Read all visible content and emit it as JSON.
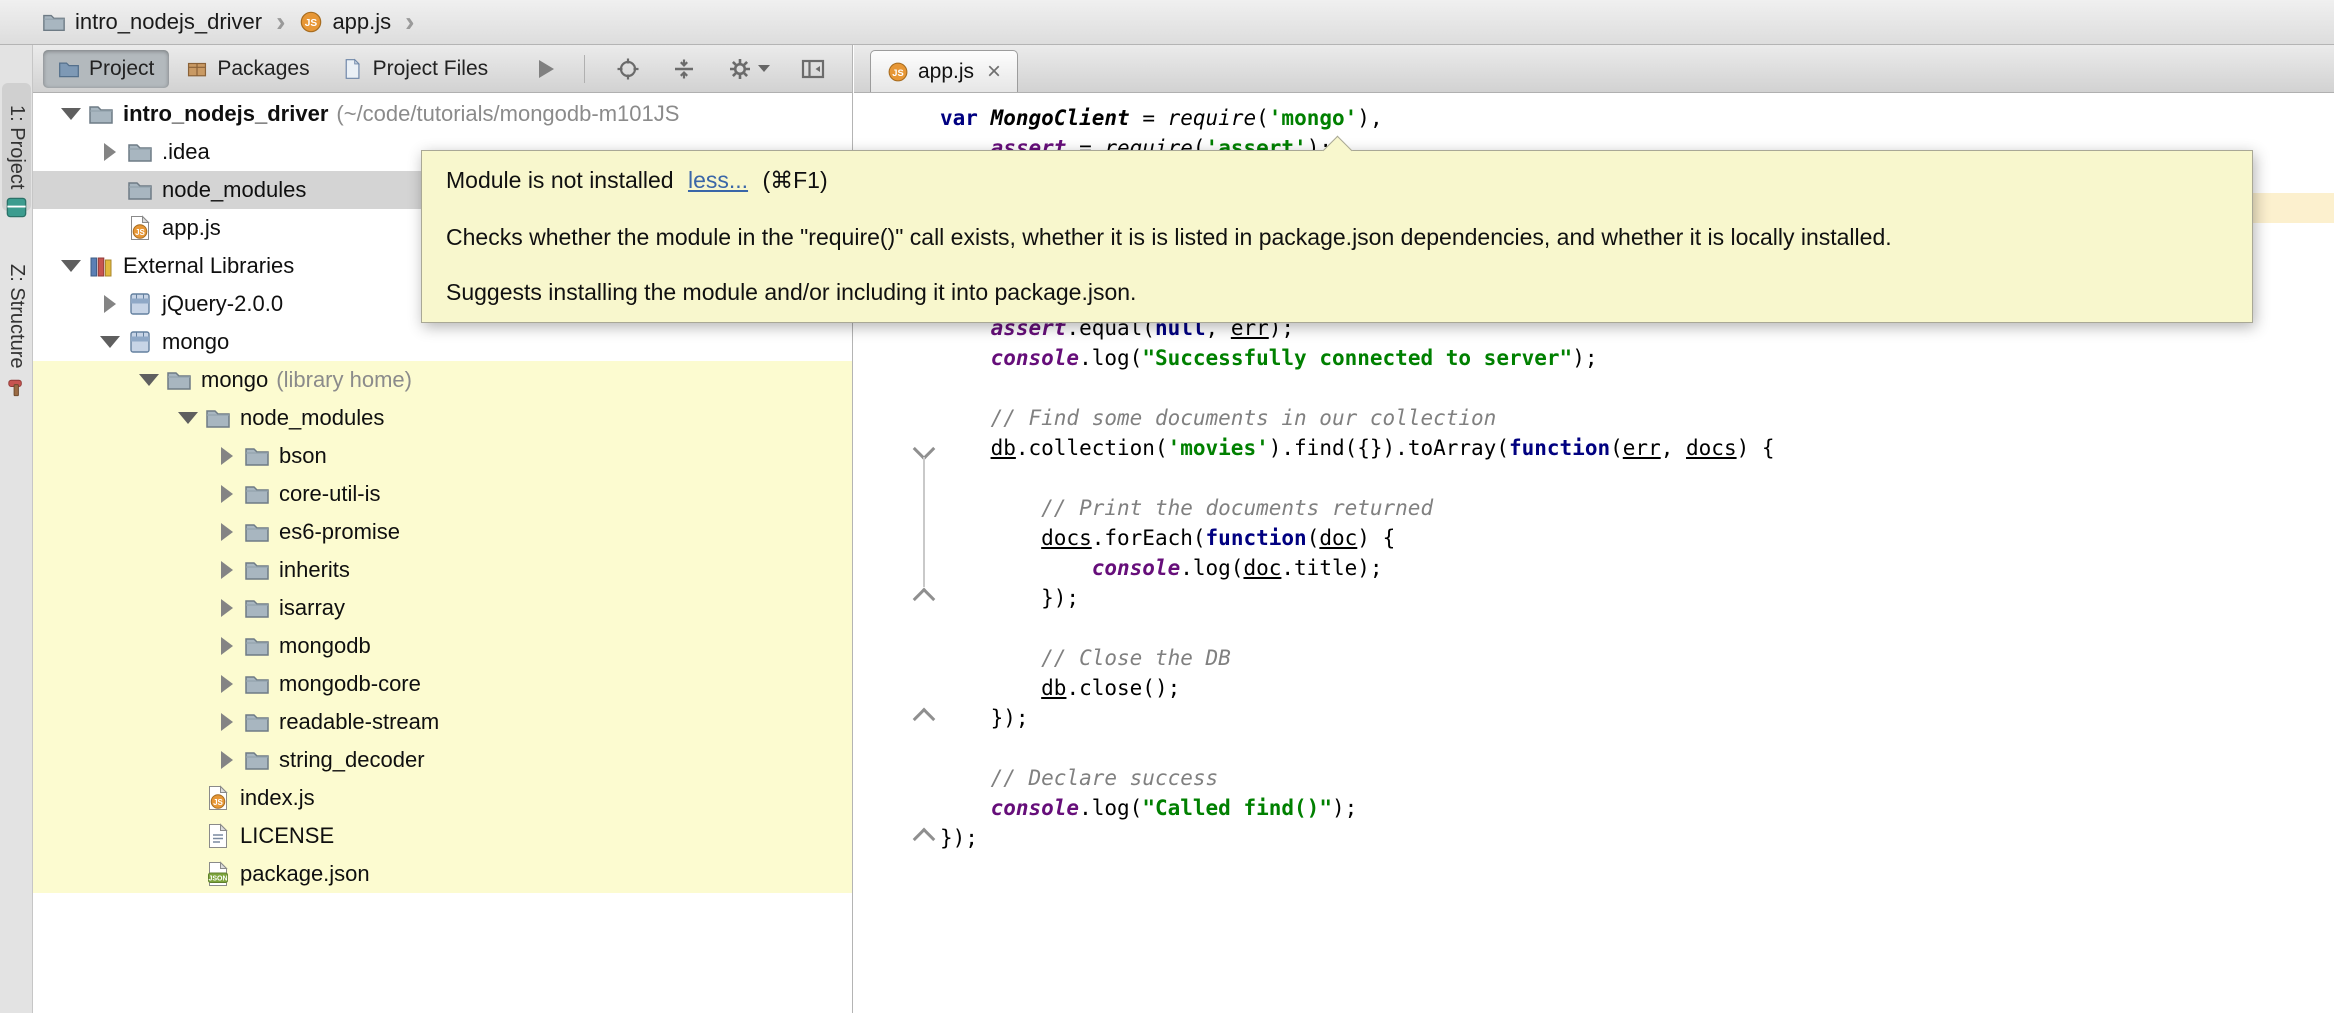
{
  "colors": {
    "tooltip_bg": "#F8F7CD",
    "selection_bg": "#D4D4D4",
    "library_highlight_bg": "#FCFBD0",
    "current_line_bg": "#FCF0CE",
    "link_color": "#3A66A8",
    "keyword_color": "#000080",
    "string_color": "#008000",
    "comment_color": "#808080",
    "member_color": "#660E7A"
  },
  "breadcrumb": {
    "items": [
      {
        "label": "intro_nodejs_driver",
        "icon": "folder"
      },
      {
        "label": "app.js",
        "icon": "js-ball"
      }
    ]
  },
  "left_strip": {
    "tabs": [
      {
        "label": "1: Project"
      },
      {
        "label": "Z: Structure"
      }
    ]
  },
  "project_panel": {
    "tabs": [
      {
        "label": "Project",
        "icon": "project-tab",
        "selected": true
      },
      {
        "label": "Packages",
        "icon": "packages-tab",
        "selected": false
      },
      {
        "label": "Project Files",
        "icon": "files-tab",
        "selected": false
      }
    ],
    "tree": [
      {
        "level": 0,
        "arrow": "open",
        "icon": "folder",
        "label": "intro_nodejs_driver",
        "extra": "(~/code/tutorials/mongodb-m101JS",
        "bold": true
      },
      {
        "level": 1,
        "arrow": "closed",
        "icon": "folder",
        "label": ".idea"
      },
      {
        "level": 1,
        "arrow": null,
        "icon": "folder",
        "label": "node_modules",
        "selected": true
      },
      {
        "level": 1,
        "arrow": null,
        "icon": "js-file",
        "label": "app.js"
      },
      {
        "level": 0,
        "arrow": "open",
        "icon": "external-libs",
        "label": "External Libraries"
      },
      {
        "level": 1,
        "arrow": "closed",
        "icon": "library",
        "label": "jQuery-2.0.0"
      },
      {
        "level": 1,
        "arrow": "open",
        "icon": "library",
        "label": "mongo"
      },
      {
        "level": 2,
        "arrow": "open",
        "icon": "folder",
        "label": "mongo",
        "extra": "(library home)",
        "highlight": true
      },
      {
        "level": 3,
        "arrow": "open",
        "icon": "folder",
        "label": "node_modules",
        "highlight": true
      },
      {
        "level": 4,
        "arrow": "closed",
        "icon": "folder",
        "label": "bson",
        "highlight": true
      },
      {
        "level": 4,
        "arrow": "closed",
        "icon": "folder",
        "label": "core-util-is",
        "highlight": true
      },
      {
        "level": 4,
        "arrow": "closed",
        "icon": "folder",
        "label": "es6-promise",
        "highlight": true
      },
      {
        "level": 4,
        "arrow": "closed",
        "icon": "folder",
        "label": "inherits",
        "highlight": true
      },
      {
        "level": 4,
        "arrow": "closed",
        "icon": "folder",
        "label": "isarray",
        "highlight": true
      },
      {
        "level": 4,
        "arrow": "closed",
        "icon": "folder",
        "label": "mongodb",
        "highlight": true
      },
      {
        "level": 4,
        "arrow": "closed",
        "icon": "folder",
        "label": "mongodb-core",
        "highlight": true
      },
      {
        "level": 4,
        "arrow": "closed",
        "icon": "folder",
        "label": "readable-stream",
        "highlight": true
      },
      {
        "level": 4,
        "arrow": "closed",
        "icon": "folder",
        "label": "string_decoder",
        "highlight": true
      },
      {
        "level": 3,
        "arrow": null,
        "icon": "index-js",
        "label": "index.js",
        "highlight": true
      },
      {
        "level": 3,
        "arrow": null,
        "icon": "text-file",
        "label": "LICENSE",
        "highlight": true
      },
      {
        "level": 3,
        "arrow": null,
        "icon": "json-file",
        "label": "package.json",
        "highlight": true
      }
    ]
  },
  "editor": {
    "tab": {
      "label": "app.js"
    },
    "fold_markers": [
      {
        "line": 12,
        "dir": "down"
      },
      {
        "line": 17,
        "dir": "up"
      },
      {
        "line": 21,
        "dir": "up"
      },
      {
        "line": 25,
        "dir": "up"
      }
    ],
    "fold_line": {
      "from": 12,
      "to": 17
    },
    "code_lines": [
      [
        [
          "kw",
          "var"
        ],
        [
          "pl",
          " "
        ],
        [
          "cls",
          "MongoClient"
        ],
        [
          "pl",
          " = "
        ],
        [
          "fn",
          "require"
        ],
        [
          "pl",
          "("
        ],
        [
          "str",
          "'mongo'"
        ],
        [
          "pl",
          "),"
        ]
      ],
      [
        [
          "pl",
          "    "
        ],
        [
          "mem",
          "assert"
        ],
        [
          "pl",
          " = "
        ],
        [
          "fn",
          "require"
        ],
        [
          "pl",
          "("
        ],
        [
          "str",
          "'assert'"
        ],
        [
          "pl",
          ");"
        ]
      ],
      [],
      [],
      [],
      [],
      [],
      [
        [
          "pl",
          "    "
        ],
        [
          "mem",
          "assert"
        ],
        [
          "pl",
          ".equal("
        ],
        [
          "kw",
          "null"
        ],
        [
          "pl",
          ", "
        ],
        [
          "var",
          "err"
        ],
        [
          "pl",
          ");"
        ]
      ],
      [
        [
          "pl",
          "    "
        ],
        [
          "mem",
          "console"
        ],
        [
          "pl",
          ".log("
        ],
        [
          "str",
          "\"Successfully connected to server\""
        ],
        [
          "pl",
          ");"
        ]
      ],
      [],
      [
        [
          "pl",
          "    "
        ],
        [
          "cmt",
          "// Find some documents in our collection"
        ]
      ],
      [
        [
          "pl",
          "    "
        ],
        [
          "var",
          "db"
        ],
        [
          "pl",
          ".collection("
        ],
        [
          "str",
          "'movies'"
        ],
        [
          "pl",
          ").find({}).toArray("
        ],
        [
          "kw",
          "function"
        ],
        [
          "pl",
          "("
        ],
        [
          "var",
          "err"
        ],
        [
          "pl",
          ", "
        ],
        [
          "var",
          "docs"
        ],
        [
          "pl",
          ") {"
        ]
      ],
      [],
      [
        [
          "pl",
          "        "
        ],
        [
          "cmt",
          "// Print the documents returned"
        ]
      ],
      [
        [
          "pl",
          "        "
        ],
        [
          "var",
          "docs"
        ],
        [
          "pl",
          ".forEach("
        ],
        [
          "kw",
          "function"
        ],
        [
          "pl",
          "("
        ],
        [
          "var",
          "doc"
        ],
        [
          "pl",
          ") {"
        ]
      ],
      [
        [
          "pl",
          "            "
        ],
        [
          "mem",
          "console"
        ],
        [
          "pl",
          ".log("
        ],
        [
          "var",
          "doc"
        ],
        [
          "pl",
          ".title);"
        ]
      ],
      [
        [
          "pl",
          "        });"
        ]
      ],
      [],
      [
        [
          "pl",
          "        "
        ],
        [
          "cmt",
          "// Close the DB"
        ]
      ],
      [
        [
          "pl",
          "        "
        ],
        [
          "var",
          "db"
        ],
        [
          "pl",
          ".close();"
        ]
      ],
      [
        [
          "pl",
          "    });"
        ]
      ],
      [],
      [
        [
          "pl",
          "    "
        ],
        [
          "cmt",
          "// Declare success"
        ]
      ],
      [
        [
          "pl",
          "    "
        ],
        [
          "mem",
          "console"
        ],
        [
          "pl",
          ".log("
        ],
        [
          "str",
          "\"Called find()\""
        ],
        [
          "pl",
          ");"
        ]
      ],
      [
        [
          "pl",
          "});"
        ]
      ]
    ]
  },
  "tooltip": {
    "title": "Module is not installed",
    "link": "less...",
    "shortcut": "(⌘F1)",
    "body1": "Checks whether the module in the \"require()\" call exists, whether it is is listed in package.json dependencies, and whether it is locally installed.",
    "body2": "Suggests installing the module and/or including it into package.json."
  }
}
